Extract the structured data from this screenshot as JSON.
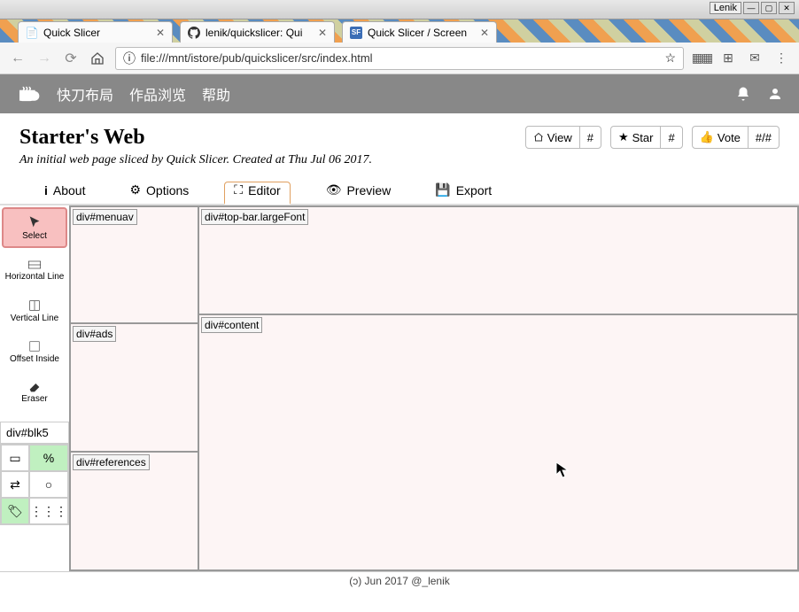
{
  "window": {
    "active_title": "Lenik"
  },
  "browser": {
    "tabs": [
      {
        "icon": "page",
        "title": "Quick Slicer"
      },
      {
        "icon": "github",
        "title": "lenik/quickslicer: Qui"
      },
      {
        "icon": "sf",
        "title": "Quick Slicer / Screen"
      }
    ],
    "url": "file:///mnt/istore/pub/quickslicer/src/index.html"
  },
  "app": {
    "nav": [
      "快刀布局",
      "作品浏览",
      "帮助"
    ]
  },
  "page": {
    "title": "Starter's Web",
    "subtitle": "An initial web page sliced by Quick Slicer. Created at Thu Jul 06 2017."
  },
  "actions": {
    "view": {
      "label": "View",
      "count": "#"
    },
    "star": {
      "label": "Star",
      "count": "#"
    },
    "vote": {
      "label": "Vote",
      "count": "#/#"
    }
  },
  "tabs": {
    "about": "About",
    "options": "Options",
    "editor": "Editor",
    "preview": "Preview",
    "export": "Export"
  },
  "tools": {
    "select": "Select",
    "hline": "Horizontal Line",
    "vline": "Vertical Line",
    "offset": "Offset Inside",
    "eraser": "Eraser",
    "current_id": "div#blk5",
    "percent": "%"
  },
  "regions": {
    "menuav": "div#menuav",
    "topbar": "div#top-bar.largeFont",
    "ads": "div#ads",
    "content": "div#content",
    "references": "div#references"
  },
  "footer": "(ɔ) Jun 2017 @_lenik"
}
